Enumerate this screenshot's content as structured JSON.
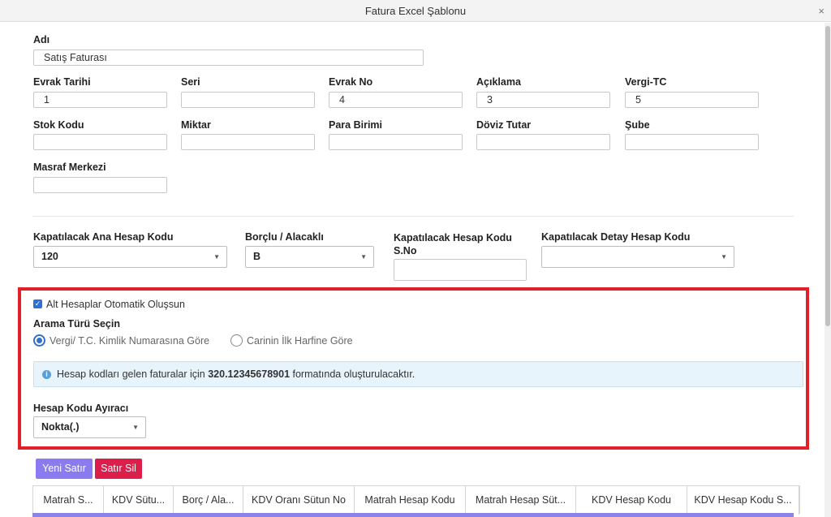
{
  "window": {
    "title": "Fatura Excel Şablonu",
    "close_glyph": "×"
  },
  "form": {
    "adi": {
      "label": "Adı",
      "value": "Satış Faturası"
    },
    "evrak_tarihi": {
      "label": "Evrak Tarihi",
      "value": "1"
    },
    "seri": {
      "label": "Seri",
      "value": ""
    },
    "evrak_no": {
      "label": "Evrak No",
      "value": "4"
    },
    "aciklama": {
      "label": "Açıklama",
      "value": "3"
    },
    "vergi_tc": {
      "label": "Vergi-TC",
      "value": "5"
    },
    "stok_kodu": {
      "label": "Stok Kodu",
      "value": ""
    },
    "miktar": {
      "label": "Miktar",
      "value": ""
    },
    "para_birimi": {
      "label": "Para Birimi",
      "value": ""
    },
    "doviz_tutar": {
      "label": "Döviz Tutar",
      "value": ""
    },
    "sube": {
      "label": "Şube",
      "value": ""
    },
    "masraf_merkezi": {
      "label": "Masraf Merkezi",
      "value": ""
    }
  },
  "closing": {
    "ana_hesap": {
      "label": "Kapatılacak Ana Hesap Kodu",
      "value": "120"
    },
    "borclu": {
      "label": "Borçlu / Alacaklı",
      "value": "B"
    },
    "hesap_sno": {
      "label_line1": "Kapatılacak Hesap Kodu",
      "label_line2": "S.No",
      "value": ""
    },
    "detay_hesap": {
      "label": "Kapatılacak Detay Hesap Kodu",
      "value": ""
    }
  },
  "highlight": {
    "auto_checkbox_label": "Alt Hesaplar Otomatik Oluşsun",
    "auto_checked": true,
    "search_type_title": "Arama Türü Seçin",
    "radio_vergi": "Vergi/ T.C. Kimlik Numarasına Göre",
    "radio_harf": "Carinin İlk Harfine Göre",
    "selected_radio": "vergi",
    "info_prefix": "Hesap kodları gelen faturalar için ",
    "info_code": "320.12345678901",
    "info_suffix": " formatında oluşturulacaktır.",
    "separator_label": "Hesap Kodu Ayıracı",
    "separator_value": "Nokta(.)"
  },
  "buttons": {
    "new_row": "Yeni Satır",
    "delete_row": "Satır Sil"
  },
  "colors": {
    "new_row": "#8a7cf0",
    "delete_row": "#dc1e4a",
    "highlight_border": "#e02127",
    "accent": "#2f6fd6"
  },
  "grid": {
    "columns": [
      "Matrah S...",
      "KDV Sütu...",
      "Borç / Ala...",
      "KDV Oranı Sütun No",
      "Matrah Hesap Kodu",
      "Matrah Hesap Süt...",
      "KDV Hesap Kodu",
      "KDV Hesap Kodu S..."
    ]
  }
}
